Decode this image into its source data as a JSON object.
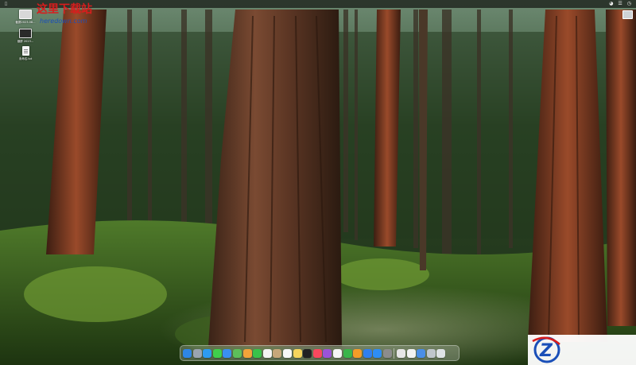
{
  "menubar": {
    "left_items": [
      "",
      "",
      "",
      ""
    ],
    "status_icons": [
      "wifi-icon",
      "control-center-icon",
      "clock"
    ]
  },
  "desktop_icons": [
    {
      "label": "截屏2023-08...",
      "kind": "screenshot"
    },
    {
      "label": "截屏 2023...",
      "kind": "screenshot"
    },
    {
      "label": "未命名.txt",
      "kind": "document"
    }
  ],
  "dock": {
    "apps": [
      {
        "name": "finder",
        "color": "#2f86e6"
      },
      {
        "name": "launchpad",
        "color": "#9aa4b0"
      },
      {
        "name": "safari",
        "color": "#2d9bf0"
      },
      {
        "name": "messages",
        "color": "#3fcf4c"
      },
      {
        "name": "mail",
        "color": "#3a8ff0"
      },
      {
        "name": "maps",
        "color": "#5cbf5a"
      },
      {
        "name": "photos",
        "color": "#f2a33a"
      },
      {
        "name": "facetime",
        "color": "#39c24a"
      },
      {
        "name": "calendar",
        "color": "#f4f4f4"
      },
      {
        "name": "contacts",
        "color": "#c6a77a"
      },
      {
        "name": "reminders",
        "color": "#f7f7f7"
      },
      {
        "name": "notes",
        "color": "#f6d55c"
      },
      {
        "name": "tv",
        "color": "#222222"
      },
      {
        "name": "music",
        "color": "#f8485e"
      },
      {
        "name": "podcasts",
        "color": "#9b53d8"
      },
      {
        "name": "news",
        "color": "#f5f5f5"
      },
      {
        "name": "numbers",
        "color": "#39b54a"
      },
      {
        "name": "pages",
        "color": "#f39c28"
      },
      {
        "name": "keynote",
        "color": "#2f7ff0"
      },
      {
        "name": "app-store",
        "color": "#2e8df3"
      },
      {
        "name": "system-settings",
        "color": "#8c8c8c"
      }
    ],
    "right_apps": [
      {
        "name": "preview",
        "color": "#e6e6e6"
      },
      {
        "name": "textedit",
        "color": "#f2f2f2"
      },
      {
        "name": "downloads-stack",
        "color": "#4a8ee6"
      },
      {
        "name": "documents-stack",
        "color": "#c0c6cc"
      },
      {
        "name": "trash",
        "color": "#dfe3e6"
      }
    ]
  },
  "watermark": {
    "title": "这里下载站",
    "subtitle": "heredown.com"
  }
}
